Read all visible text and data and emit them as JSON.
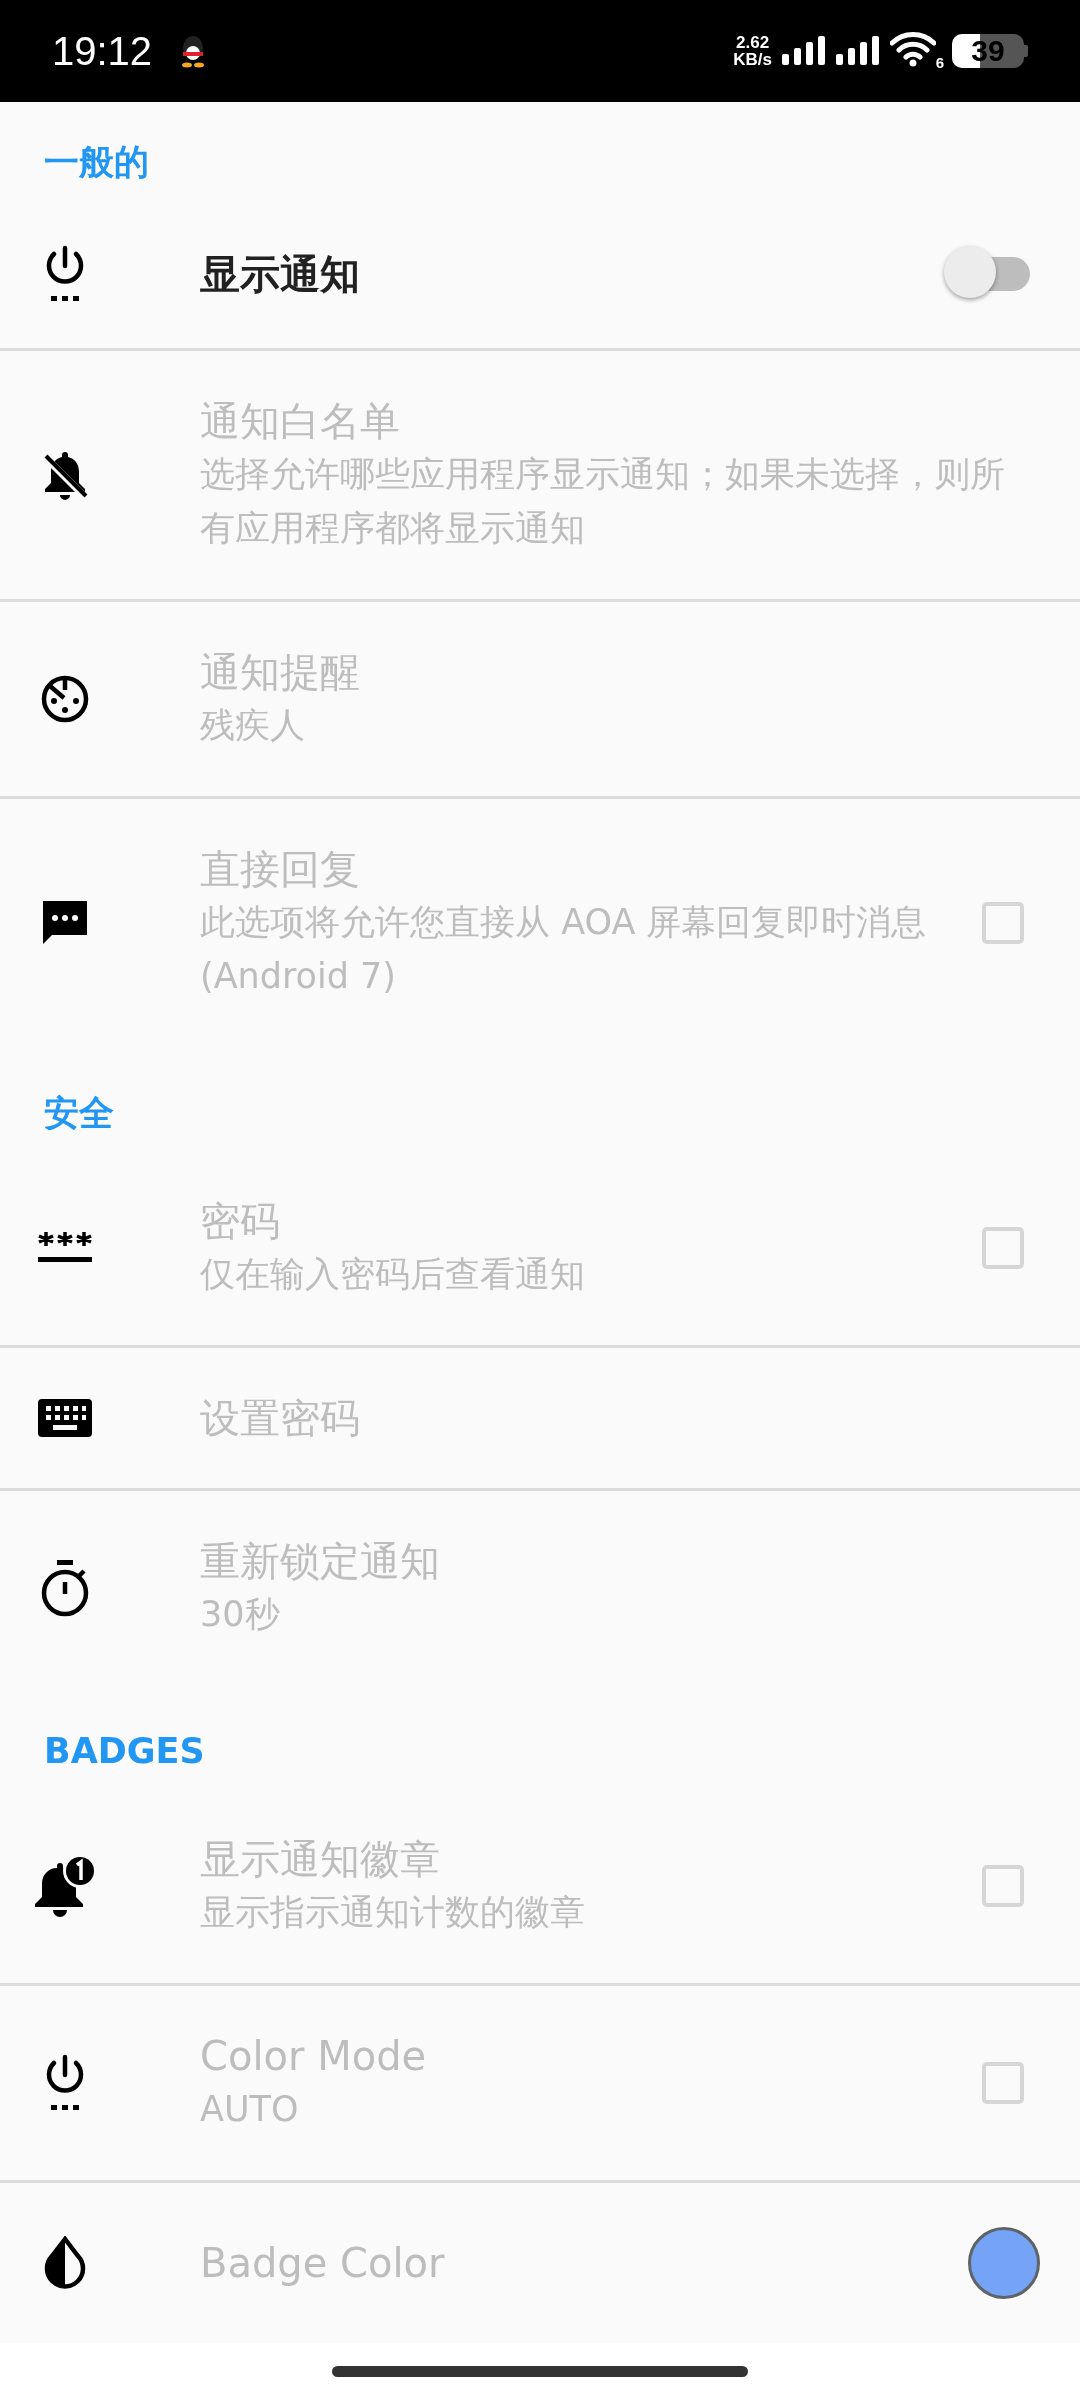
{
  "status_bar": {
    "time": "19:12",
    "net_speed": "2.62",
    "net_unit": "KB/s",
    "wifi_label": "6",
    "battery": "39"
  },
  "sections": [
    {
      "title": "一般的",
      "items": [
        {
          "kind": "switch",
          "title": "显示通知",
          "disabled": false,
          "on": false
        },
        {
          "kind": "plain",
          "title": "通知白名单",
          "subtitle": "选择允许哪些应用程序显示通知；如果未选择，则所有应用程序都将显示通知",
          "disabled": true
        },
        {
          "kind": "plain",
          "title": "通知提醒",
          "subtitle": "残疾人",
          "disabled": true
        },
        {
          "kind": "checkbox",
          "title": "直接回复",
          "subtitle": "此选项将允许您直接从 AOA 屏幕回复即时消息 (Android 7)",
          "disabled": true,
          "checked": false
        }
      ]
    },
    {
      "title": "安全",
      "items": [
        {
          "kind": "checkbox",
          "title": "密码",
          "subtitle": "仅在输入密码后查看通知",
          "disabled": true,
          "checked": false
        },
        {
          "kind": "plain",
          "title": "设置密码",
          "disabled": true
        },
        {
          "kind": "plain",
          "title": "重新锁定通知",
          "subtitle": "30秒",
          "disabled": true
        }
      ]
    },
    {
      "title": "BADGES",
      "items": [
        {
          "kind": "checkbox",
          "title": "显示通知徽章",
          "subtitle": "显示指示通知计数的徽章",
          "disabled": true,
          "checked": false
        },
        {
          "kind": "checkbox",
          "title": "Color Mode",
          "subtitle": "AUTO",
          "disabled": true,
          "checked": false
        },
        {
          "kind": "color",
          "title": "Badge Color",
          "disabled": true,
          "color": "#75a4f7"
        }
      ]
    }
  ]
}
